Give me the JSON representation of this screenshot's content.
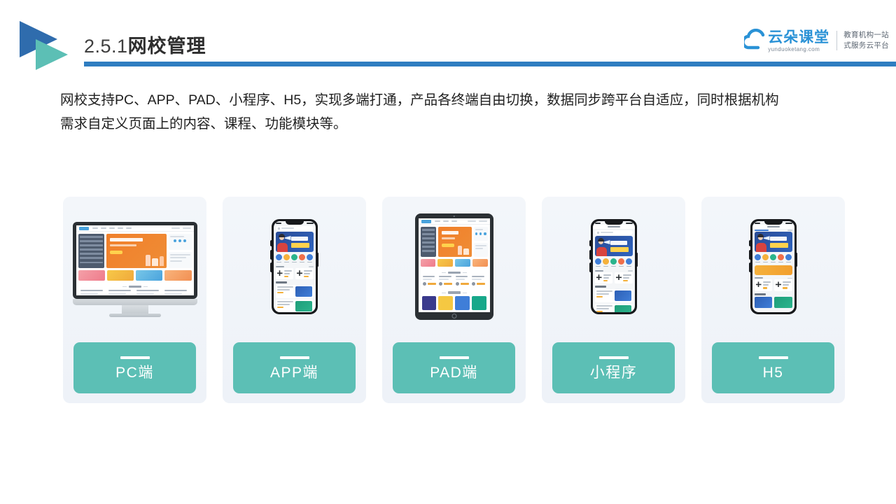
{
  "header": {
    "title_number": "2.5.1",
    "title_text": "网校管理",
    "logo_icon": "double-triangle-play-icon"
  },
  "brand": {
    "name_cn": "云朵课堂",
    "domain": "yunduoketang.com",
    "tagline_line1": "教育机构一站",
    "tagline_line2": "式服务云平台",
    "cloud_icon": "cloud-icon",
    "accent_color": "#2a92d6"
  },
  "body": {
    "paragraph_line1": "网校支持PC、APP、PAD、小程序、H5，实现多端打通，产品各终端自由切换，数据同步跨平台自适应，同时根据机构",
    "paragraph_line2": "需求自定义页面上的内容、课程、功能模块等。"
  },
  "colors": {
    "accent_blue": "#2f7dc1",
    "accent_teal": "#5cbfb5",
    "card_bg": "#f1f4f9",
    "title_dark": "#2e2e2e"
  },
  "cards": [
    {
      "label": "PC端",
      "device": "desktop-monitor",
      "device_icon": "imac-icon"
    },
    {
      "label": "APP端",
      "device": "smartphone",
      "device_icon": "iphone-icon"
    },
    {
      "label": "PAD端",
      "device": "tablet",
      "device_icon": "ipad-icon"
    },
    {
      "label": "小程序",
      "device": "smartphone",
      "device_icon": "iphone-icon"
    },
    {
      "label": "H5",
      "device": "smartphone",
      "device_icon": "iphone-icon"
    }
  ]
}
